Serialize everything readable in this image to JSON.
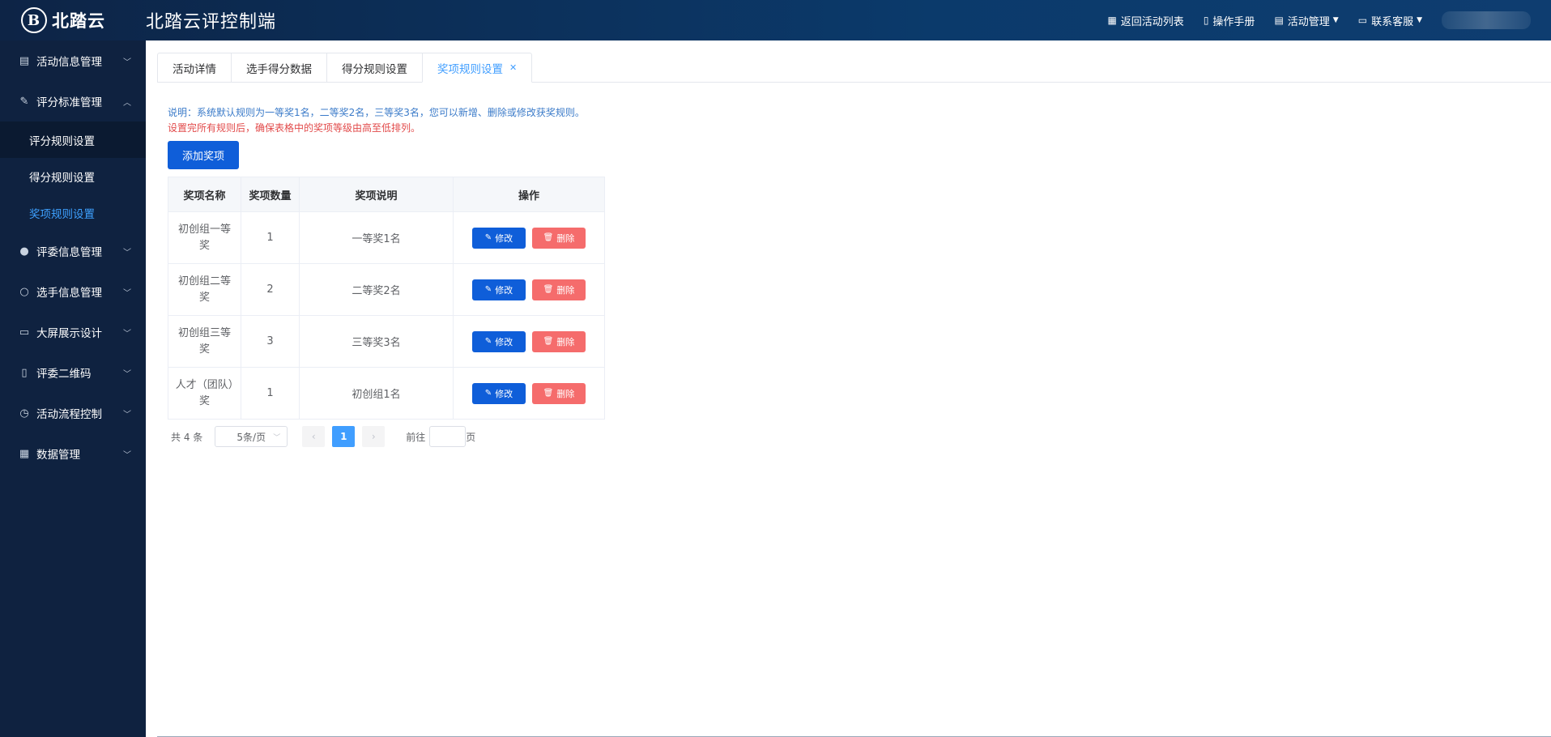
{
  "header": {
    "logo_mark": "B",
    "logo_text": "北踏云",
    "title": "北踏云评控制端",
    "nav": [
      {
        "icon": "grid-icon",
        "label": "返回活动列表"
      },
      {
        "icon": "book-icon",
        "label": "操作手册"
      },
      {
        "icon": "document-icon",
        "label": "活动管理"
      },
      {
        "icon": "chat-icon",
        "label": "联系客服"
      }
    ]
  },
  "sidebar": {
    "items": [
      {
        "label": "活动信息管理"
      },
      {
        "label": "评分标准管理"
      },
      {
        "label": "评分规则设置"
      },
      {
        "label": "得分规则设置"
      },
      {
        "label": "奖项规则设置"
      },
      {
        "label": "评委信息管理"
      },
      {
        "label": "选手信息管理"
      },
      {
        "label": "大屏展示设计"
      },
      {
        "label": "评委二维码"
      },
      {
        "label": "活动流程控制"
      },
      {
        "label": "数据管理"
      }
    ]
  },
  "tabs": [
    {
      "label": "活动详情"
    },
    {
      "label": "选手得分数据"
    },
    {
      "label": "得分规则设置"
    },
    {
      "label": "奖项规则设置"
    }
  ],
  "notes": {
    "line1": "说明：系统默认规则为一等奖1名，二等奖2名，三等奖3名，您可以新增、删除或修改获奖规则。",
    "line2": "设置完所有规则后，确保表格中的奖项等级由高至低排列。"
  },
  "add_button": "添加奖项",
  "table": {
    "headers": [
      "奖项名称",
      "奖项数量",
      "奖项说明",
      "操作"
    ],
    "rows": [
      {
        "name": "初创组一等奖",
        "count": "1",
        "desc": "一等奖1名"
      },
      {
        "name": "初创组二等奖",
        "count": "2",
        "desc": "二等奖2名"
      },
      {
        "name": "初创组三等奖",
        "count": "3",
        "desc": "三等奖3名"
      },
      {
        "name": "人才（团队）奖",
        "count": "1",
        "desc": "初创组1名"
      }
    ],
    "edit_label": "修改",
    "delete_label": "删除"
  },
  "pagination": {
    "total": "共 4 条",
    "page_size": "5条/页",
    "current_page": "1",
    "goto_label": "前往",
    "page_suffix": "页"
  }
}
